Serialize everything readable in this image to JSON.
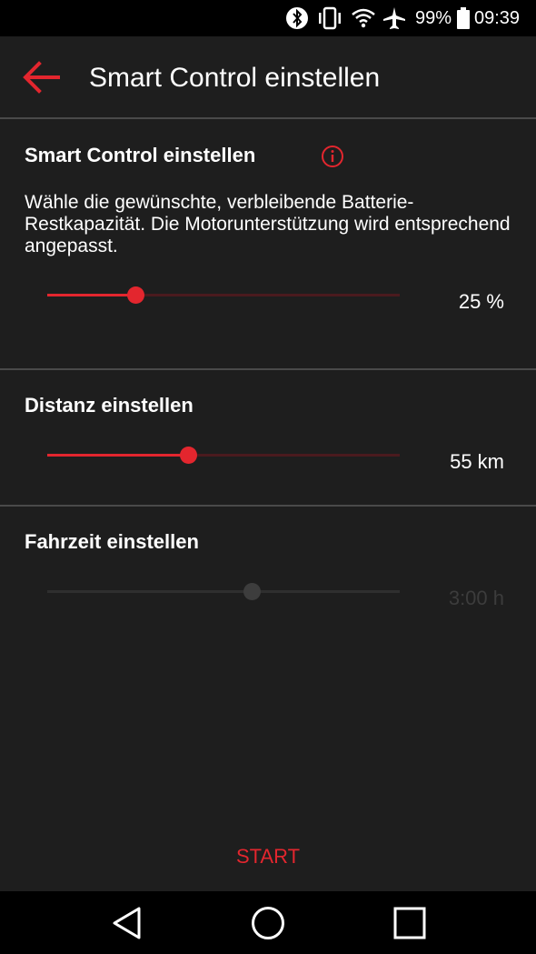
{
  "status_bar": {
    "battery_percent": "99%",
    "time": "09:39",
    "icons": [
      "bluetooth-icon",
      "vibrate-icon",
      "wifi-icon",
      "airplane-icon",
      "battery-icon"
    ]
  },
  "app_bar": {
    "title": "Smart Control einstellen",
    "back_icon": "arrow-left-icon"
  },
  "colors": {
    "accent": "#e3262e",
    "background": "#1e1e1e",
    "track_inactive": "#4a1a1e",
    "disabled": "#3c3c3c"
  },
  "smart_control": {
    "title": "Smart Control einstellen",
    "info_icon": "info-icon",
    "description": "Wähle die gewünschte, verbleibende Batterie-Restkapazität. Die Motorunterstützung wird entsprechend angepasst.",
    "value_label": "25 %",
    "level": 0.25,
    "enabled": true
  },
  "distance": {
    "title": "Distanz einstellen",
    "value_label": "55 km",
    "level": 0.4,
    "enabled": true
  },
  "ride_time": {
    "title": "Fahrzeit einstellen",
    "value_label": "3:00 h",
    "level": 0.58,
    "enabled": false
  },
  "actions": {
    "start_label": "START"
  },
  "nav_bar": {
    "icons": [
      "back-triangle-icon",
      "home-circle-icon",
      "recents-square-icon"
    ]
  }
}
